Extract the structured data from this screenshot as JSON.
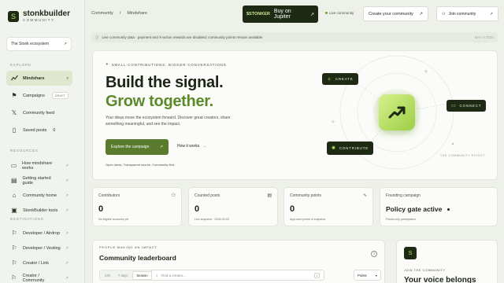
{
  "brand": {
    "name": "stonkbuilder",
    "sub": "COMMUNITY",
    "mark": "S"
  },
  "ecosystem": {
    "label": "The Stonk ecosystem",
    "icon": "external-link-icon"
  },
  "sidebar": {
    "explore_label": "EXPLORE",
    "explore": [
      {
        "label": "Mindshare",
        "icon": "trend-icon",
        "active": true,
        "end": "▾"
      },
      {
        "label": "Campaigns",
        "icon": "flag-icon",
        "badge": "DRAFT"
      },
      {
        "label": "Community feed",
        "icon": "x-logo-icon"
      },
      {
        "label": "Saved posts",
        "icon": "bookmark-icon",
        "count": "0"
      }
    ],
    "resources_label": "RESOURCES",
    "resources": [
      {
        "label": "How mindshare works",
        "icon": "book-icon"
      },
      {
        "label": "Getting started guide",
        "icon": "doc-icon"
      },
      {
        "label": "Community home",
        "icon": "home-icon"
      },
      {
        "label": "StonkBuilder tools",
        "icon": "tools-icon"
      }
    ],
    "destinations_label": "DESTINATIONS",
    "destinations": [
      {
        "label": "Developer / Airdrop",
        "icon": "flag-icon"
      },
      {
        "label": "Developer / Vesting",
        "icon": "flag-icon"
      },
      {
        "label": "Creator / Link",
        "icon": "flag-icon"
      },
      {
        "label": "Creator / Community",
        "icon": "flag-icon"
      }
    ]
  },
  "topbar": {
    "crumb_root": "Community",
    "crumb_sep": "/",
    "crumb_current": "Mindshare",
    "buy_tag": "$STONKER",
    "buy_label": "Buy on Jupiter",
    "live": "Live community",
    "create_label": "Create your community",
    "join_label": "Join community"
  },
  "notice": {
    "text": "Live community data · payment and X-action rewards are disabled; community points remain available.",
    "right": "MAY 8 2025"
  },
  "hero": {
    "eyebrow": "SMALL CONTRIBUTIONS. BIGGER CONVERSATIONS.",
    "title_a": "Build the signal.",
    "title_b": "Grow together.",
    "desc": "Your ideas move the ecosystem forward. Discover great creators, share something meaningful, and see the impact.",
    "cta": "Explore the campaign",
    "secondary": "How it works",
    "footnote": "Open ideas. Transparent scores. Community first.",
    "pills": {
      "create": "CREATE",
      "connect": "CONNECT",
      "contribute": "CONTRIBUTE"
    },
    "effect": "THE COMMUNITY EFFECT"
  },
  "stats": [
    {
      "label": "Contributors",
      "icon": "users-icon",
      "value": "0",
      "sub": "No eligible accounts yet"
    },
    {
      "label": "Counted posts",
      "icon": "doc-icon",
      "value": "0",
      "sub": "Live snapshot · 2026-09-03"
    },
    {
      "label": "Community points",
      "icon": "pulse-icon",
      "value": "0",
      "sub": "Approved points in snapshot"
    },
    {
      "label": "Founding campaign",
      "icon": "",
      "value": "Policy gate active",
      "sub": "Points-only participation"
    }
  ],
  "leaderboard": {
    "eyebrow": "PEOPLE MAKING AN IMPACT",
    "title": "Community leaderboard",
    "ranges": [
      "24h",
      "7 days",
      "Season"
    ],
    "search_placeholder": "Find a creator...",
    "kbd": "/",
    "sort": "Points"
  },
  "join_card": {
    "label": "JOIN THE COMMUNITY",
    "title": "Your voice belongs"
  },
  "colors": {
    "accent": "#5c8a2a",
    "dark": "#1e2a14",
    "lime": "#b8e36a"
  }
}
